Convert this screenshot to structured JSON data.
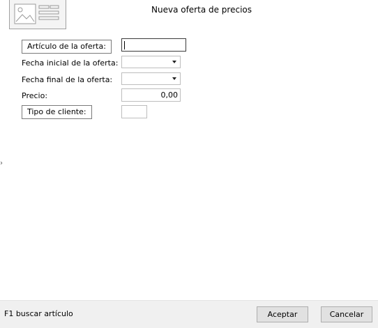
{
  "header": {
    "title": "Nueva oferta de precios",
    "image_icon": "image-placeholder-icon"
  },
  "form": {
    "articulo": {
      "label": "Artículo de la oferta:",
      "value": ""
    },
    "fecha_inicial": {
      "label": "Fecha inicial de la oferta:",
      "value": ""
    },
    "fecha_final": {
      "label": "Fecha final de la oferta:",
      "value": ""
    },
    "precio": {
      "label": "Precio:",
      "value": "0,00"
    },
    "tipo_cliente": {
      "label": "Tipo de cliente:",
      "value": ""
    }
  },
  "side_marker": "›",
  "footer": {
    "hint": "F1 buscar artículo",
    "accept_label": "Aceptar",
    "cancel_label": "Cancelar"
  }
}
